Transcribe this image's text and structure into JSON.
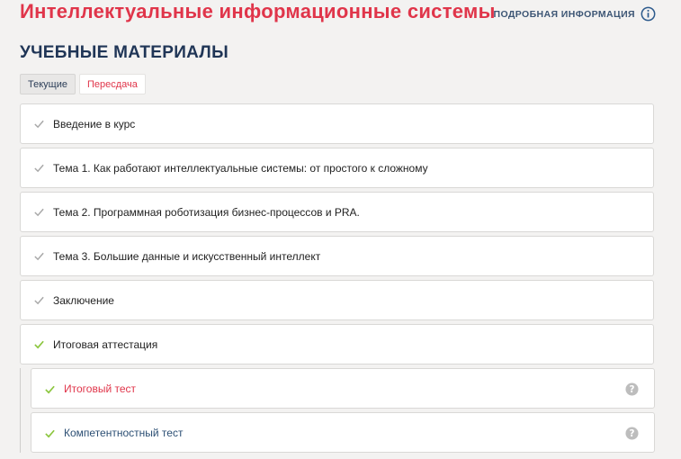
{
  "header": {
    "course_title": "Интеллектуальные информационные системы",
    "more_info_label": "ПОДРОБНАЯ ИНФОРМАЦИЯ",
    "info_icon": "info-circle-icon"
  },
  "section": {
    "title": "УЧЕБНЫЕ МАТЕРИАЛЫ"
  },
  "tabs": [
    {
      "label": "Текущие"
    },
    {
      "label": "Пересдача"
    }
  ],
  "items": [
    {
      "label": "Введение в курс",
      "status": "completed-grey"
    },
    {
      "label": "Тема 1. Как работают интеллектуальные системы: от простого к сложному",
      "status": "completed-grey"
    },
    {
      "label": "Тема 2. Программная роботизация бизнес-процессов и PRA.",
      "status": "completed-grey"
    },
    {
      "label": "Тема 3. Большие данные и искусственный интеллект",
      "status": "completed-grey"
    },
    {
      "label": "Заключение",
      "status": "completed-grey"
    },
    {
      "label": "Итоговая аттестация",
      "status": "completed-green"
    }
  ],
  "subitems": [
    {
      "label": "Итоговый тест",
      "color": "#e0354a",
      "icon": "help-circle-icon"
    },
    {
      "label": "Компетентностный тест",
      "color": "#2c4f74",
      "icon": "help-circle-icon"
    }
  ],
  "colors": {
    "brand_red": "#e0354a",
    "navy": "#1f3556",
    "check_grey": "#a8a8a8",
    "check_green": "#8cc63f"
  }
}
